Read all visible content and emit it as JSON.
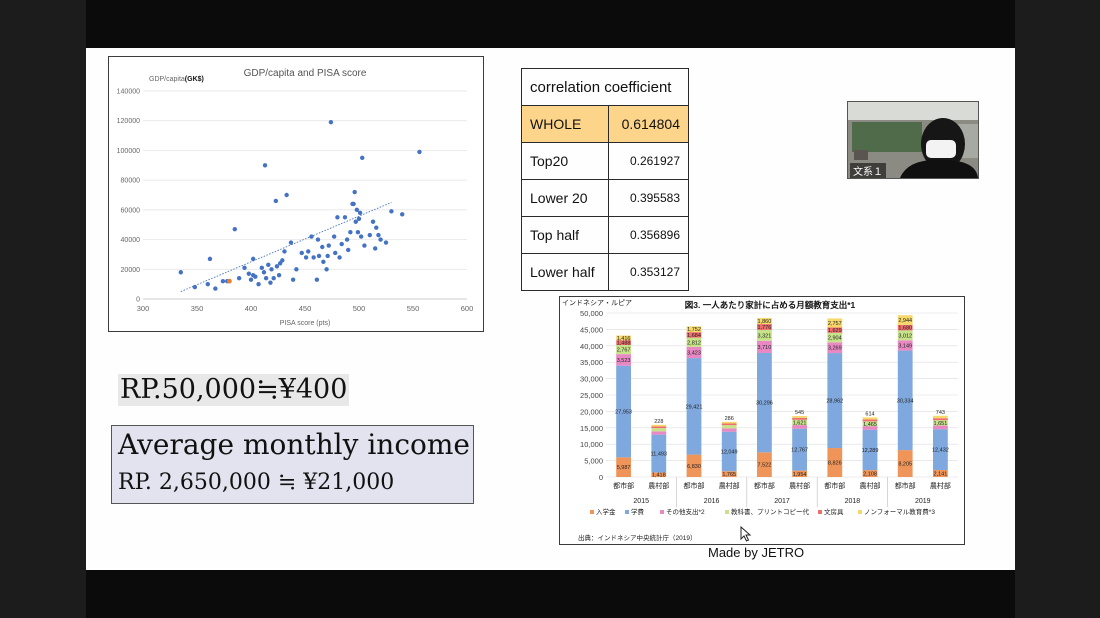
{
  "scatter": {
    "title": "GDP/capita and  PISA score",
    "ylabel_prefix": "GDP/capita",
    "ylabel_unit": "(GK$)",
    "xlabel": "PISA score (pts)",
    "y_ticks": [
      "0",
      "20000",
      "40000",
      "60000",
      "80000",
      "100000",
      "120000",
      "140000"
    ],
    "x_ticks": [
      "300",
      "350",
      "400",
      "450",
      "500",
      "550",
      "600"
    ]
  },
  "chart_data": [
    {
      "type": "scatter",
      "title": "GDP/capita and  PISA score",
      "xlabel": "PISA score (pts)",
      "ylabel": "GDP/capita(GK$)",
      "xlim": [
        300,
        600
      ],
      "ylim": [
        0,
        140000
      ],
      "trendline": [
        [
          335,
          5000
        ],
        [
          530,
          65000
        ]
      ],
      "points": [
        [
          335,
          18000
        ],
        [
          348,
          8000
        ],
        [
          360,
          10000
        ],
        [
          362,
          27000
        ],
        [
          367,
          7000
        ],
        [
          374,
          12000
        ],
        [
          378,
          12000
        ],
        [
          385,
          47000
        ],
        [
          389,
          14000
        ],
        [
          394,
          21000
        ],
        [
          398,
          17000
        ],
        [
          400,
          13000
        ],
        [
          402,
          16000
        ],
        [
          402,
          27000
        ],
        [
          404,
          15000
        ],
        [
          407,
          10000
        ],
        [
          410,
          21000
        ],
        [
          412,
          18000
        ],
        [
          413,
          90000
        ],
        [
          414,
          14000
        ],
        [
          416,
          23000
        ],
        [
          418,
          11000
        ],
        [
          419,
          20000
        ],
        [
          421,
          14000
        ],
        [
          423,
          66000
        ],
        [
          424,
          22000
        ],
        [
          426,
          16000
        ],
        [
          427,
          24000
        ],
        [
          429,
          26000
        ],
        [
          431,
          32000
        ],
        [
          433,
          70000
        ],
        [
          437,
          38000
        ],
        [
          439,
          13000
        ],
        [
          442,
          20000
        ],
        [
          447,
          31000
        ],
        [
          451,
          28000
        ],
        [
          453,
          32000
        ],
        [
          456,
          42000
        ],
        [
          458,
          28000
        ],
        [
          461,
          13000
        ],
        [
          462,
          40000
        ],
        [
          463,
          29000
        ],
        [
          466,
          35000
        ],
        [
          467,
          25000
        ],
        [
          470,
          20000
        ],
        [
          471,
          29000
        ],
        [
          472,
          36000
        ],
        [
          474,
          119000
        ],
        [
          477,
          42000
        ],
        [
          478,
          31000
        ],
        [
          480,
          55000
        ],
        [
          482,
          28000
        ],
        [
          484,
          37000
        ],
        [
          487,
          55000
        ],
        [
          489,
          40000
        ],
        [
          490,
          33000
        ],
        [
          492,
          45000
        ],
        [
          494,
          64000
        ],
        [
          495,
          64000
        ],
        [
          496,
          72000
        ],
        [
          497,
          52000
        ],
        [
          498,
          60000
        ],
        [
          499,
          45000
        ],
        [
          500,
          54000
        ],
        [
          501,
          58000
        ],
        [
          502,
          42000
        ],
        [
          503,
          95000
        ],
        [
          505,
          36000
        ],
        [
          510,
          43000
        ],
        [
          513,
          52000
        ],
        [
          515,
          34000
        ],
        [
          516,
          48000
        ],
        [
          518,
          43000
        ],
        [
          520,
          40000
        ],
        [
          525,
          38000
        ],
        [
          530,
          59000
        ],
        [
          540,
          57000
        ],
        [
          556,
          99000
        ]
      ],
      "highlight_points": [
        [
          380,
          12000
        ]
      ]
    },
    {
      "type": "bar",
      "title": "図3. 一人あたり家計に占める月額教育支出*1",
      "unit_label": "インドネシア・ルピア",
      "ylim": [
        0,
        50000
      ],
      "y_ticks": [
        "0",
        "5,000",
        "10,000",
        "15,000",
        "20,000",
        "25,000",
        "30,000",
        "35,000",
        "40,000",
        "45,000",
        "50,000"
      ],
      "categories": [
        "都市部",
        "農村部",
        "都市部",
        "農村部",
        "都市部",
        "農村部",
        "都市部",
        "農村部",
        "都市部",
        "農村部"
      ],
      "years": [
        "2015",
        "2016",
        "2017",
        "2018",
        "2019"
      ],
      "series": [
        {
          "name": "入学金",
          "color": "#f0955a",
          "values": [
            5987,
            1418,
            6830,
            1765,
            7522,
            1954,
            8826,
            2108,
            8205,
            2141
          ],
          "labels": [
            "5,987",
            "1,418",
            "6,830",
            "1,765",
            "7,522",
            "1,954",
            "8,826",
            "2,108",
            "8,205",
            "2,141"
          ]
        },
        {
          "name": "学費",
          "color": "#7fa8de",
          "values": [
            27953,
            11493,
            29421,
            12049,
            30296,
            12767,
            28962,
            12289,
            30334,
            12432
          ],
          "labels": [
            "27,953",
            "11,493",
            "29,421",
            "12,049",
            "30,296",
            "12,767",
            "28,962",
            "12,289",
            "30,334",
            "12,432"
          ]
        },
        {
          "name": "その他支出*2",
          "color": "#e889c4",
          "values": [
            3523,
            1000,
            3423,
            1000,
            3710,
            1100,
            3269,
            1100,
            3149,
            1100
          ],
          "labels": [
            "3,523",
            "",
            "3,423",
            "",
            "3,710",
            "",
            "3,269",
            "",
            "3,149",
            ""
          ]
        },
        {
          "name": "教科書、プリントコピー代",
          "color": "#c7e38a",
          "values": [
            2767,
            1000,
            2812,
            1000,
            3321,
            1621,
            2904,
            1465,
            3012,
            1651
          ],
          "labels": [
            "2,767",
            "",
            "2,812",
            "",
            "3,321",
            "1,621",
            "2,904",
            "1,465",
            "3,012",
            "1,651"
          ]
        },
        {
          "name": "文房具",
          "color": "#ef6d6d",
          "values": [
            1488,
            500,
            1684,
            500,
            1776,
            600,
            1629,
            600,
            1680,
            600
          ],
          "labels": [
            "1,488",
            "",
            "1,684",
            "",
            "1,776",
            "",
            "1,629",
            "",
            "1,680",
            ""
          ]
        },
        {
          "name": "ノンフォーマル教育費*3",
          "color": "#f6d96a",
          "values": [
            1416,
            500,
            1752,
            500,
            1860,
            545,
            2757,
            614,
            2944,
            743
          ],
          "labels": [
            "1,416",
            "",
            "1,752",
            "",
            "1,860",
            "",
            "2,757",
            "",
            "2,944",
            ""
          ]
        }
      ],
      "top_labels": [
        "",
        "228",
        "",
        "286",
        "",
        "545",
        "",
        "614",
        "",
        "743"
      ],
      "source": "出典：インドネシア中央統計庁（2019）"
    }
  ],
  "correlation": {
    "header": "correlation coefficient",
    "rows": [
      {
        "label": "WHOLE",
        "value": "0.614804"
      },
      {
        "label": "Top20",
        "value": "0.261927"
      },
      {
        "label": "Lower 20",
        "value": "0.395583"
      },
      {
        "label": "Top half",
        "value": "0.356896"
      },
      {
        "label": "Lower half",
        "value": "0.353127"
      }
    ]
  },
  "exchange_rate": "RP.50,000≒¥400",
  "income": {
    "title": "Average monthly income",
    "value": "RP. 2,650,000 ≒ ¥21,000"
  },
  "webcam": {
    "label": "文系１"
  },
  "credit": "Made by JETRO",
  "colors": {
    "scatter_point": "#4472c4",
    "highlight_point": "#ed7d31",
    "table_highlight": "#fdd58a",
    "income_bg": "#e2e3ee"
  }
}
